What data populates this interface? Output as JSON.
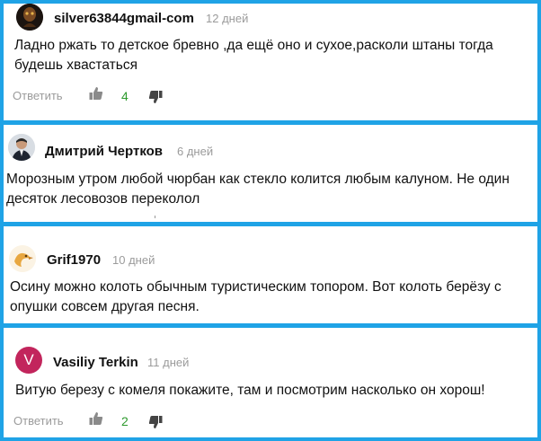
{
  "comments": [
    {
      "author": "silver63844gmail-com",
      "date": "12 дней",
      "lines": [
        "Ладно ржать то детское бревно ,да ещё оно и сухое,расколи штаны тогда",
        "будешь хвастаться"
      ],
      "reply_label": "Ответить",
      "likes": "4"
    },
    {
      "author": "Дмитрий Чертков",
      "date": "6 дней",
      "lines": [
        "Морозным утром любой чюрбан как стекло колится любым калуном. Не один",
        "десяток лесовозов переколол"
      ]
    },
    {
      "author": "Grif1970",
      "date": "10 дней",
      "lines": [
        "Осину можно колоть обычным туристическим топором. Вот колоть берёзу с",
        "опушки совсем другая песня."
      ]
    },
    {
      "author": "Vasiliy Terkin",
      "avatar_letter": "V",
      "date": "11 дней",
      "lines": [
        "Витую березу с комеля покажите, там и посмотрим насколько он хорош!"
      ],
      "reply_label": "Ответить",
      "likes": "2"
    }
  ],
  "colors": {
    "frame": "#1fa3e6",
    "likes_green": "#2e9a2e",
    "muted": "#9b9b9b",
    "avatar_v": "#c2255c"
  }
}
